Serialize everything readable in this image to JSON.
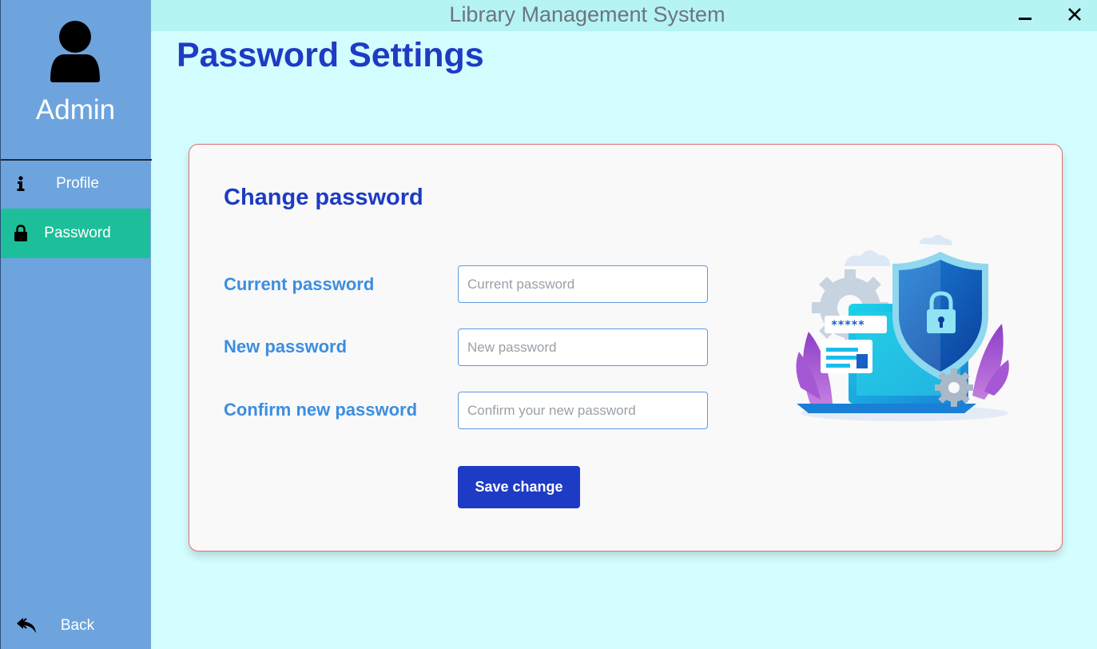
{
  "app": {
    "window_title": "Library Management System",
    "minimize_icon": "minimize-icon",
    "close_icon": "close-icon"
  },
  "sidebar": {
    "user_icon": "user-avatar-icon",
    "user_label": "Admin",
    "items": [
      {
        "label": "Profile",
        "icon": "info-icon",
        "active": false
      },
      {
        "label": "Password",
        "icon": "lock-icon",
        "active": true
      }
    ],
    "back": {
      "label": "Back",
      "icon": "reply-arrow-icon"
    }
  },
  "page": {
    "title": "Password Settings"
  },
  "form": {
    "title": "Change password",
    "fields": [
      {
        "label": "Current password",
        "placeholder": "Current password",
        "value": ""
      },
      {
        "label": "New password",
        "placeholder": "New password",
        "value": ""
      },
      {
        "label": "Confirm new password",
        "placeholder": "Confirm your new password",
        "value": ""
      }
    ],
    "submit_label": "Save change",
    "illustration": {
      "icon": "security-shield-laptop-illustration",
      "password_mask": "*****"
    }
  },
  "colors": {
    "sidebar": "#6ea4dd",
    "active_nav": "#1dbf9a",
    "background": "#d4fdff",
    "titlebar": "#b6f3f3",
    "heading": "#1d3bc4",
    "label": "#3c8ee0",
    "card_border": "#e07070",
    "button": "#1d3bc4"
  }
}
